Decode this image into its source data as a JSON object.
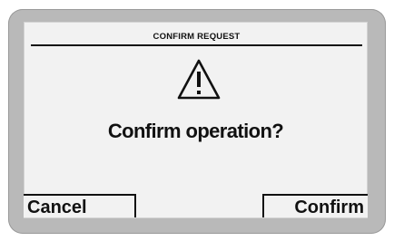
{
  "dialog": {
    "title": "CONFIRM REQUEST",
    "icon": "warning-triangle-icon",
    "message": "Confirm operation?"
  },
  "softkeys": {
    "left_label": "Cancel",
    "right_label": "Confirm"
  },
  "colors": {
    "screen_background": "#f2f2f2",
    "bezel": "#b9b9b9",
    "text": "#111111"
  }
}
